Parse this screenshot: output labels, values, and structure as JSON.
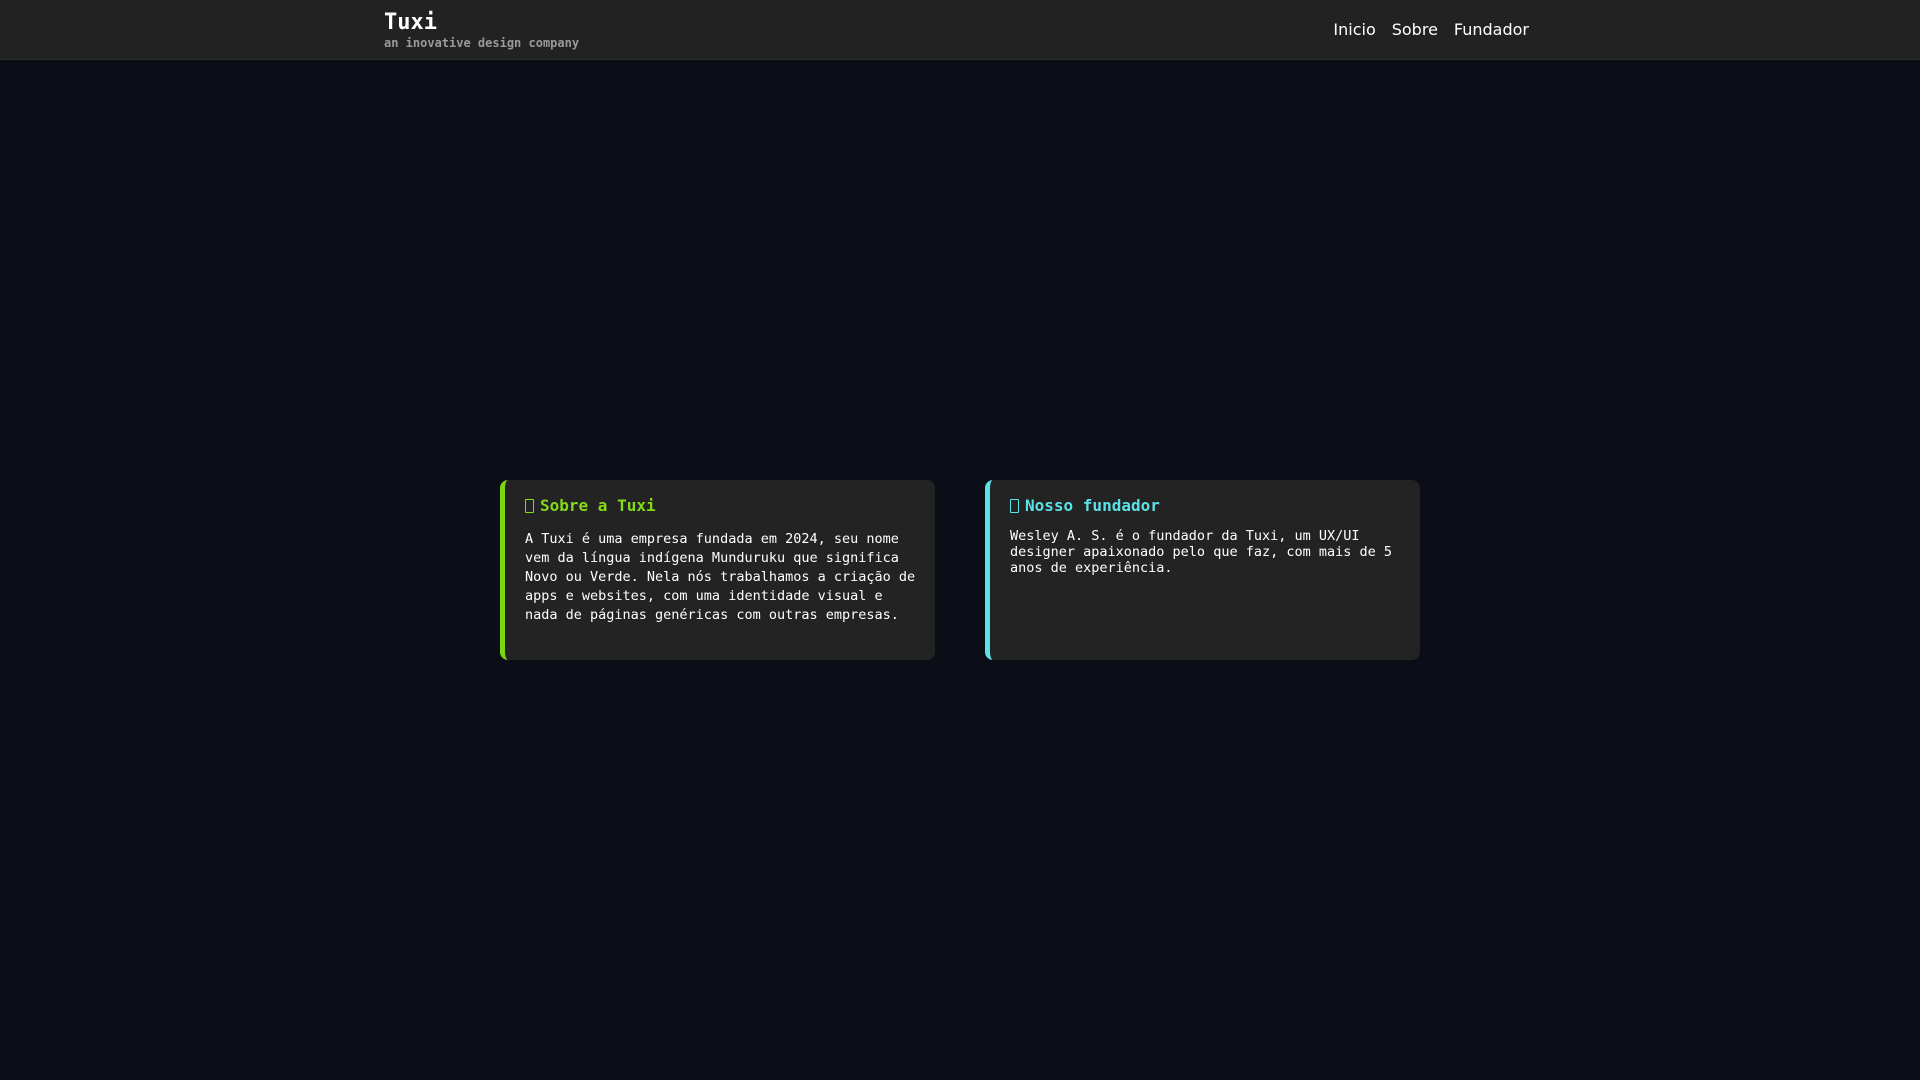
{
  "header": {
    "title": "Tuxi",
    "tagline": "an inovative design company",
    "nav": [
      {
        "label": "Inicio"
      },
      {
        "label": "Sobre"
      },
      {
        "label": "Fundador"
      }
    ]
  },
  "cards": [
    {
      "icon": "info-icon",
      "title": "Sobre a Tuxi",
      "text": "A Tuxi é uma empresa fundada em 2024, seu nome vem da língua indígena Munduruku que significa Novo ou Verde. Nela nós trabalhamos a criação de apps e websites, com uma identidade visual e nada de páginas genéricas com outras empresas.",
      "accent": "#7bd60d"
    },
    {
      "icon": "user-icon",
      "title": "Nosso fundador",
      "text": "Wesley A. S. é o fundador da Tuxi, um UX/UI designer apaixonado pelo que faz, com mais de 5 anos de experiência.",
      "accent": "#5ce1e6"
    }
  ],
  "colors": {
    "background": "#0b0e16",
    "header": "#222222",
    "card": "#232323"
  }
}
